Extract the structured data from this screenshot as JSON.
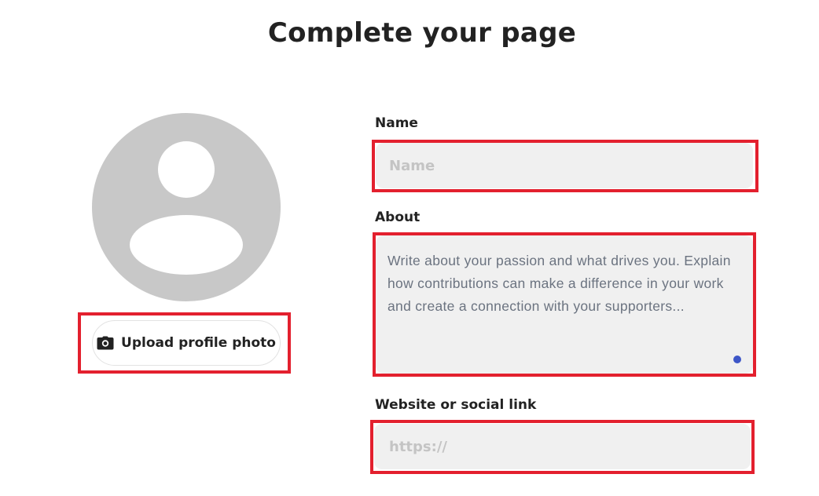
{
  "page": {
    "title": "Complete your page"
  },
  "profile": {
    "avatar_icon": "default-user-avatar-icon",
    "upload_button_label": "Upload profile photo",
    "upload_icon": "camera-icon"
  },
  "form": {
    "name": {
      "label": "Name",
      "placeholder": "Name",
      "value": ""
    },
    "about": {
      "label": "About",
      "placeholder": "Write about your passion and what drives you. Explain how contributions can make a difference in your work and create a connection with your supporters..."
    },
    "website": {
      "label": "Website or social link",
      "placeholder": "https://",
      "value": ""
    }
  },
  "colors": {
    "highlight": "#e3202e",
    "field_background": "#f0f0f0",
    "avatar": "#c8c8c8",
    "accent_dot": "#3d56c7"
  }
}
